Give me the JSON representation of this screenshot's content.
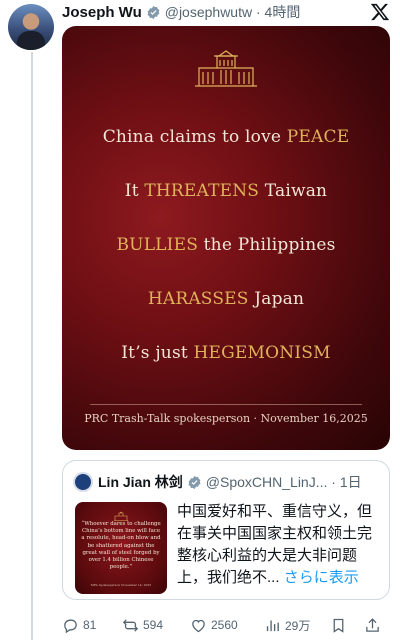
{
  "post": {
    "author_name": "Joseph Wu",
    "handle_time": "@josephwutw · 4時間"
  },
  "card": {
    "lines": [
      {
        "pre": "China claims to love ",
        "emph": "PEACE",
        "post": ""
      },
      {
        "pre": "It ",
        "emph": "THREATENS",
        "post": " Taiwan"
      },
      {
        "pre": "",
        "emph": "BULLIES",
        "post": " the Philippines"
      },
      {
        "pre": "",
        "emph": "HARASSES",
        "post": " Japan"
      },
      {
        "pre": "It’s just ",
        "emph": "HEGEMONISM",
        "post": ""
      }
    ],
    "footer": "PRC Trash-Talk spokesperson · November 16,2025"
  },
  "quoted": {
    "name": "Lin Jian 林剑",
    "handle_time": "@SpoxCHN_LinJ... · 1日",
    "text": "中国爱好和平、重信守义，但在事关中国国家主权和领土完整核心利益的大是大非问题上，我们绝不...",
    "more": "さらに表示",
    "thumb_text": "“Whoever dares to challenge China’s bottom line will face a resolute, head-on blow and be shattered against the great wall of steel forged by over 1.4 billion Chinese people.”",
    "thumb_footer": "MFA Spokesperson  November 14, 2025"
  },
  "actions": {
    "replies": "81",
    "reposts": "594",
    "likes": "2560",
    "views": "29万"
  },
  "colors": {
    "accent_blue": "#1d9bf0",
    "card_red": "#6e0f14",
    "gold": "#e0b35b"
  },
  "icons": [
    "verified-badge-icon",
    "x-logo-icon",
    "building-icon",
    "reply-icon",
    "repost-icon",
    "like-icon",
    "views-icon",
    "bookmark-icon",
    "share-icon"
  ]
}
